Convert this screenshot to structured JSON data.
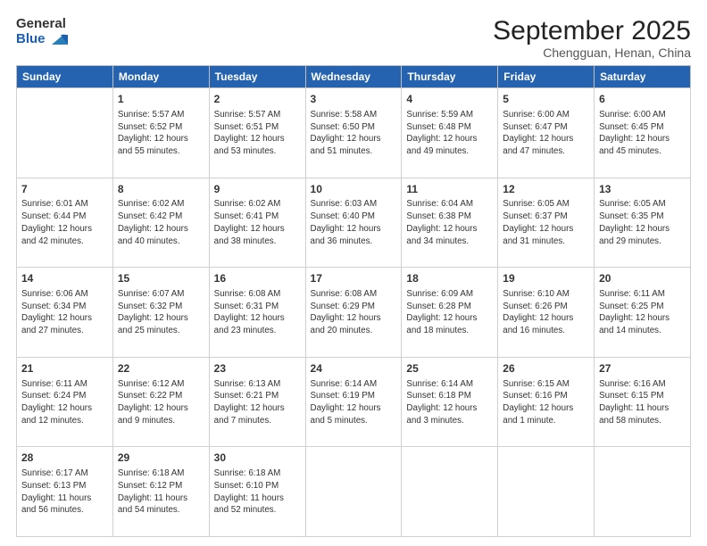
{
  "header": {
    "logo_line1": "General",
    "logo_line2": "Blue",
    "title": "September 2025",
    "subtitle": "Chengguan, Henan, China"
  },
  "weekdays": [
    "Sunday",
    "Monday",
    "Tuesday",
    "Wednesday",
    "Thursday",
    "Friday",
    "Saturday"
  ],
  "weeks": [
    [
      {
        "day": "",
        "info": ""
      },
      {
        "day": "1",
        "info": "Sunrise: 5:57 AM\nSunset: 6:52 PM\nDaylight: 12 hours\nand 55 minutes."
      },
      {
        "day": "2",
        "info": "Sunrise: 5:57 AM\nSunset: 6:51 PM\nDaylight: 12 hours\nand 53 minutes."
      },
      {
        "day": "3",
        "info": "Sunrise: 5:58 AM\nSunset: 6:50 PM\nDaylight: 12 hours\nand 51 minutes."
      },
      {
        "day": "4",
        "info": "Sunrise: 5:59 AM\nSunset: 6:48 PM\nDaylight: 12 hours\nand 49 minutes."
      },
      {
        "day": "5",
        "info": "Sunrise: 6:00 AM\nSunset: 6:47 PM\nDaylight: 12 hours\nand 47 minutes."
      },
      {
        "day": "6",
        "info": "Sunrise: 6:00 AM\nSunset: 6:45 PM\nDaylight: 12 hours\nand 45 minutes."
      }
    ],
    [
      {
        "day": "7",
        "info": "Sunrise: 6:01 AM\nSunset: 6:44 PM\nDaylight: 12 hours\nand 42 minutes."
      },
      {
        "day": "8",
        "info": "Sunrise: 6:02 AM\nSunset: 6:42 PM\nDaylight: 12 hours\nand 40 minutes."
      },
      {
        "day": "9",
        "info": "Sunrise: 6:02 AM\nSunset: 6:41 PM\nDaylight: 12 hours\nand 38 minutes."
      },
      {
        "day": "10",
        "info": "Sunrise: 6:03 AM\nSunset: 6:40 PM\nDaylight: 12 hours\nand 36 minutes."
      },
      {
        "day": "11",
        "info": "Sunrise: 6:04 AM\nSunset: 6:38 PM\nDaylight: 12 hours\nand 34 minutes."
      },
      {
        "day": "12",
        "info": "Sunrise: 6:05 AM\nSunset: 6:37 PM\nDaylight: 12 hours\nand 31 minutes."
      },
      {
        "day": "13",
        "info": "Sunrise: 6:05 AM\nSunset: 6:35 PM\nDaylight: 12 hours\nand 29 minutes."
      }
    ],
    [
      {
        "day": "14",
        "info": "Sunrise: 6:06 AM\nSunset: 6:34 PM\nDaylight: 12 hours\nand 27 minutes."
      },
      {
        "day": "15",
        "info": "Sunrise: 6:07 AM\nSunset: 6:32 PM\nDaylight: 12 hours\nand 25 minutes."
      },
      {
        "day": "16",
        "info": "Sunrise: 6:08 AM\nSunset: 6:31 PM\nDaylight: 12 hours\nand 23 minutes."
      },
      {
        "day": "17",
        "info": "Sunrise: 6:08 AM\nSunset: 6:29 PM\nDaylight: 12 hours\nand 20 minutes."
      },
      {
        "day": "18",
        "info": "Sunrise: 6:09 AM\nSunset: 6:28 PM\nDaylight: 12 hours\nand 18 minutes."
      },
      {
        "day": "19",
        "info": "Sunrise: 6:10 AM\nSunset: 6:26 PM\nDaylight: 12 hours\nand 16 minutes."
      },
      {
        "day": "20",
        "info": "Sunrise: 6:11 AM\nSunset: 6:25 PM\nDaylight: 12 hours\nand 14 minutes."
      }
    ],
    [
      {
        "day": "21",
        "info": "Sunrise: 6:11 AM\nSunset: 6:24 PM\nDaylight: 12 hours\nand 12 minutes."
      },
      {
        "day": "22",
        "info": "Sunrise: 6:12 AM\nSunset: 6:22 PM\nDaylight: 12 hours\nand 9 minutes."
      },
      {
        "day": "23",
        "info": "Sunrise: 6:13 AM\nSunset: 6:21 PM\nDaylight: 12 hours\nand 7 minutes."
      },
      {
        "day": "24",
        "info": "Sunrise: 6:14 AM\nSunset: 6:19 PM\nDaylight: 12 hours\nand 5 minutes."
      },
      {
        "day": "25",
        "info": "Sunrise: 6:14 AM\nSunset: 6:18 PM\nDaylight: 12 hours\nand 3 minutes."
      },
      {
        "day": "26",
        "info": "Sunrise: 6:15 AM\nSunset: 6:16 PM\nDaylight: 12 hours\nand 1 minute."
      },
      {
        "day": "27",
        "info": "Sunrise: 6:16 AM\nSunset: 6:15 PM\nDaylight: 11 hours\nand 58 minutes."
      }
    ],
    [
      {
        "day": "28",
        "info": "Sunrise: 6:17 AM\nSunset: 6:13 PM\nDaylight: 11 hours\nand 56 minutes."
      },
      {
        "day": "29",
        "info": "Sunrise: 6:18 AM\nSunset: 6:12 PM\nDaylight: 11 hours\nand 54 minutes."
      },
      {
        "day": "30",
        "info": "Sunrise: 6:18 AM\nSunset: 6:10 PM\nDaylight: 11 hours\nand 52 minutes."
      },
      {
        "day": "",
        "info": ""
      },
      {
        "day": "",
        "info": ""
      },
      {
        "day": "",
        "info": ""
      },
      {
        "day": "",
        "info": ""
      }
    ]
  ]
}
